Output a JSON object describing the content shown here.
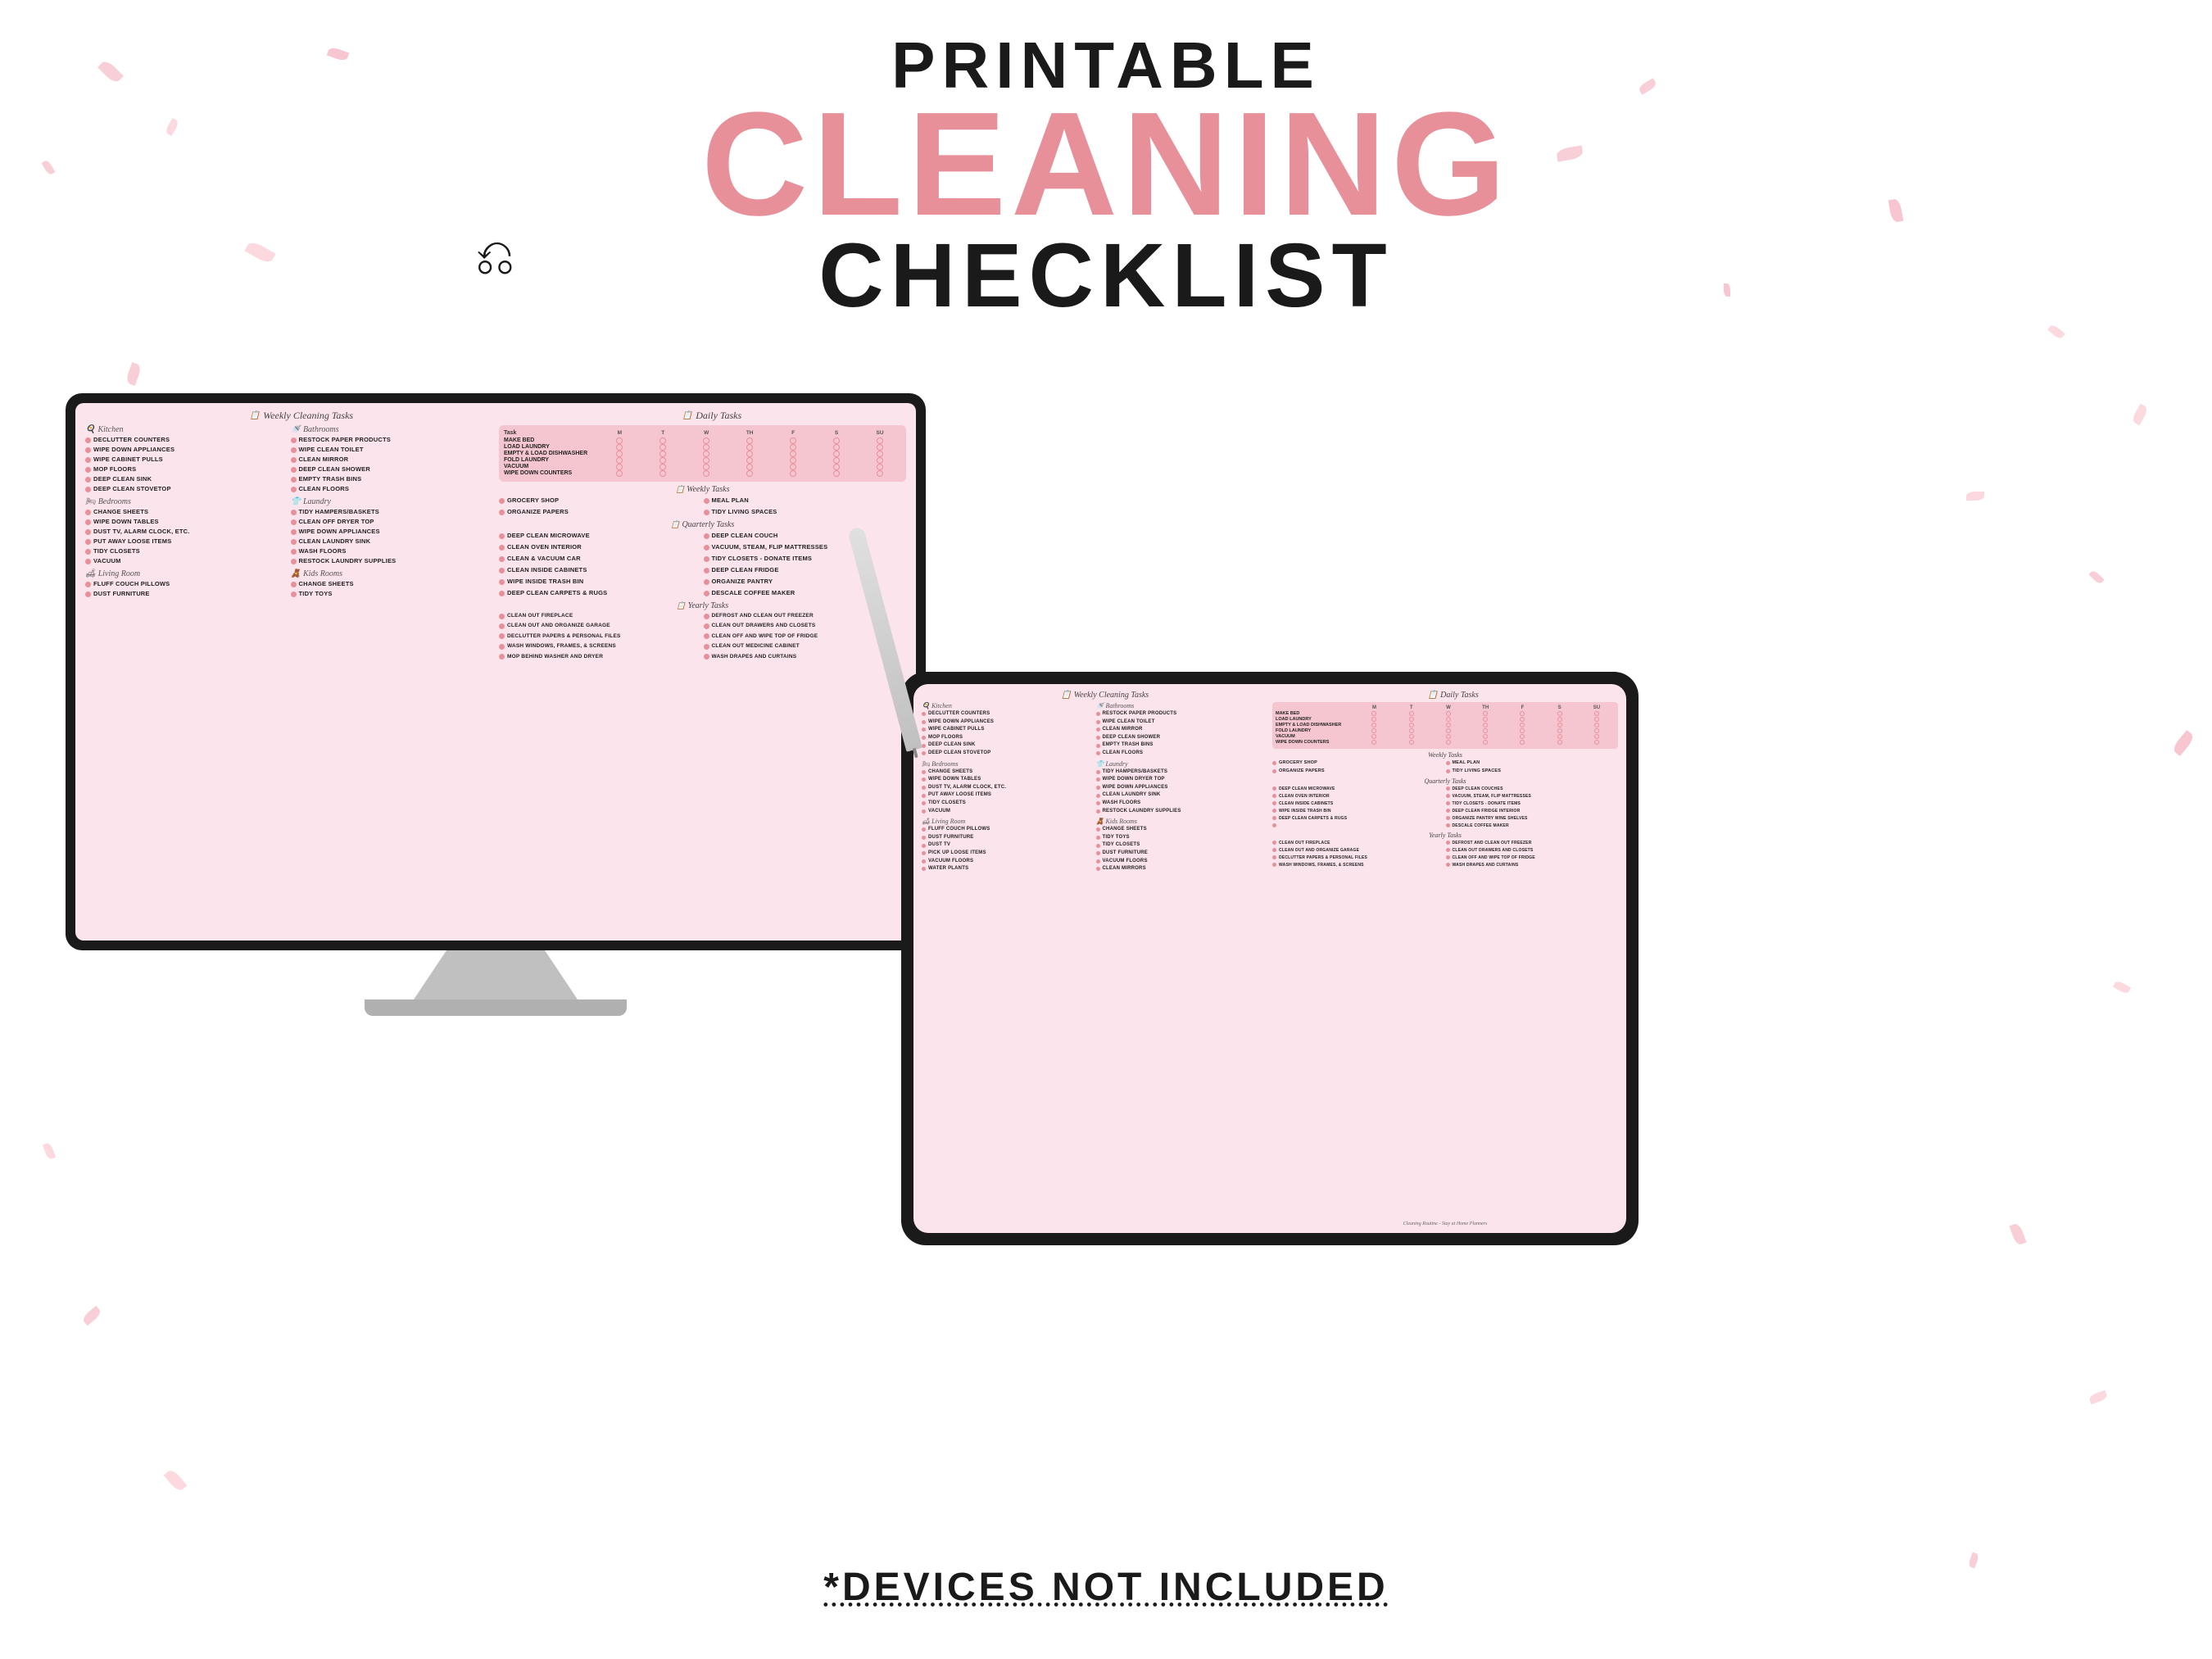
{
  "header": {
    "printable": "PRINTABLE",
    "cleaning": "CLEANING",
    "checklist": "CHECKLIST"
  },
  "bottom_text": "*DEVICES NOT INCLUDED",
  "monitor": {
    "weekly_title": "Weekly Cleaning Tasks",
    "daily_title": "Daily Tasks",
    "kitchen_label": "Kitchen",
    "kitchen_tasks": [
      "DECLUTTER COUNTERS",
      "WIPE DOWN APPLIANCES",
      "WIPE CABINET PULLS",
      "MOP FLOORS",
      "DEEP CLEAN SINK",
      "DEEP CLEAN STOVETOP"
    ],
    "bathrooms_left_label": "Bathrooms",
    "bathrooms_left_tasks": [
      "RESTOCK PAPER PRODUCTS",
      "WIPE CLEAN TOILET",
      "CLEAN MIRROR",
      "DEEP CLEAN SHOWER",
      "EMPTY TRASH BINS",
      "CLEAN FLOORS"
    ],
    "bedrooms_label": "Bedrooms",
    "bedrooms_tasks": [
      "CHANGE SHEETS",
      "WIPE DOWN TABLES",
      "DUST TV, ALARM CLOCK, ETC.",
      "PUT AWAY LOOSE ITEMS",
      "TIDY CLOSETS",
      "VACUUM"
    ],
    "laundry_label": "Laundry",
    "laundry_tasks": [
      "TIDY HAMPERS/BASKETS",
      "CLEAN OFF DRYER TOP",
      "WIPE DOWN APPLIANCES",
      "CLEAN LAUNDRY SINK",
      "WASH FLOORS",
      "RESTOCK LAUNDRY SUPPLIES"
    ],
    "living_room_label": "Living Room",
    "living_room_tasks": [
      "FLUFF COUCH PILLOWS",
      "DUST FURNITURE"
    ],
    "kids_rooms_label": "Kids Rooms",
    "kids_rooms_tasks": [
      "CHANGE SHEETS",
      "TIDY TOYS"
    ],
    "daily_tasks": [
      "MAKE BED",
      "LOAD LAUNDRY",
      "EMPTY & LOAD DISHWASHER",
      "FOLD LAUNDRY",
      "VACUUM",
      "WIPE DOWN COUNTERS"
    ],
    "days": [
      "M",
      "T",
      "W",
      "TH",
      "F",
      "S",
      "SU"
    ],
    "weekly_tasks_section": {
      "title": "Weekly Tasks",
      "tasks": [
        "GROCERY SHOP",
        "ORGANIZE PAPERS",
        "MEAL PLAN",
        "TIDY LIVING SPACES"
      ]
    },
    "quarterly_tasks": {
      "title": "Quarterly Tasks",
      "tasks_left": [
        "DEEP CLEAN MICROWAVE",
        "CLEAN OVEN INTERIOR",
        "CLEAN & VACUUM CAR",
        "CLEAN INSIDE CABINETS",
        "WIPE INSIDE TRASH BIN",
        "DEEP CLEAN CARPETS & RUGS"
      ],
      "tasks_right": [
        "DEEP CLEAN COUCH",
        "VACUUM, STEAM, FLIP MATTRESSES",
        "TIDY CLOSETS - DONATE ITEMS",
        "DEEP CLEAN FRIDGE",
        "ORGANIZE PANTRY",
        "DESCALE COFFEE MAKER"
      ]
    },
    "yearly_tasks": {
      "title": "Yearly Tasks"
    }
  },
  "tablet": {
    "weekly_title": "Weekly Cleaning Tasks",
    "daily_title": "Daily Tasks",
    "footer": "Cleaning Routine - Stay at Home Planners"
  }
}
